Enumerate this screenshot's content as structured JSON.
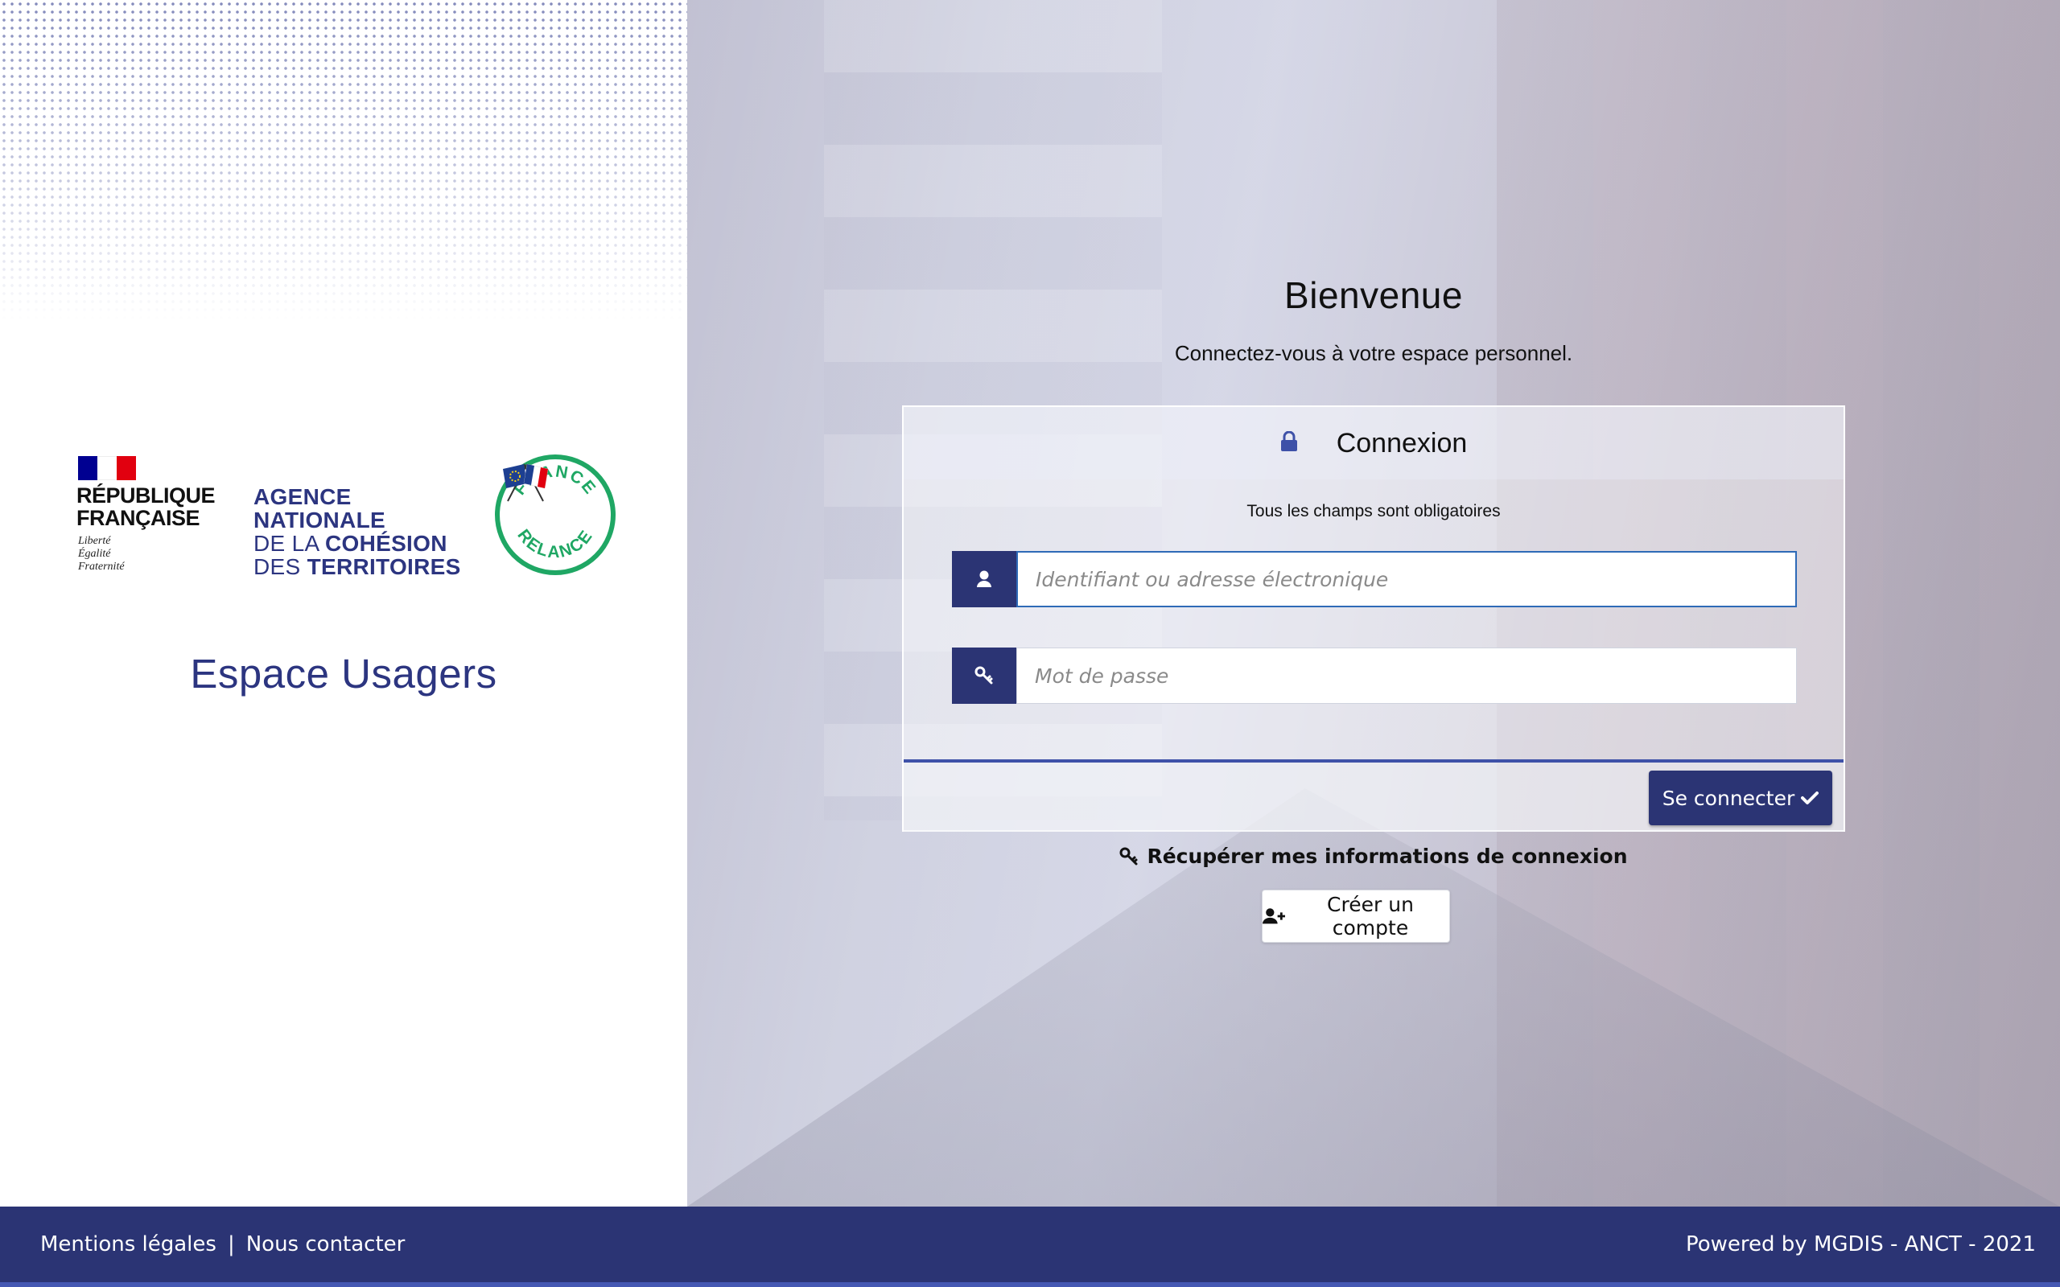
{
  "left": {
    "republique": "RÉPUBLIQUE\nFRANÇAISE",
    "motto": "Liberté\nÉgalité\nFraternité",
    "anct_lines": [
      {
        "text": "AGENCE",
        "bold": true
      },
      {
        "text": "NATIONALE",
        "bold": true
      }
    ],
    "anct_line3_prefix": "DE LA ",
    "anct_line3_bold": "COHÉSION",
    "anct_line4_prefix": "DES ",
    "anct_line4_bold": "TERRITOIRES",
    "badge_top": "FRANCE",
    "badge_bottom": "RELANCE",
    "title": "Espace Usagers"
  },
  "main": {
    "welcome_title": "Bienvenue",
    "welcome_sub": "Connectez-vous à votre espace personnel.",
    "card_title": "Connexion",
    "required_note": "Tous les champs sont obligatoires",
    "username_placeholder": "Identifiant ou adresse électronique",
    "password_placeholder": "Mot de passe",
    "connect_label": "Se connecter",
    "recover_label": "Récupérer mes informations de connexion",
    "create_label": "Créer un compte"
  },
  "icons": {
    "lock": "lock-icon",
    "user": "user-icon",
    "key": "key-icon",
    "check": "check-icon",
    "user_plus": "user-plus-icon"
  },
  "colors": {
    "brand": "#2b3474",
    "accent": "#3e51a8",
    "relance_green": "#1fa764"
  },
  "footer": {
    "legal": "Mentions légales",
    "separator": "|",
    "contact": "Nous contacter",
    "powered": "Powered by MGDIS - ANCT - 2021"
  }
}
